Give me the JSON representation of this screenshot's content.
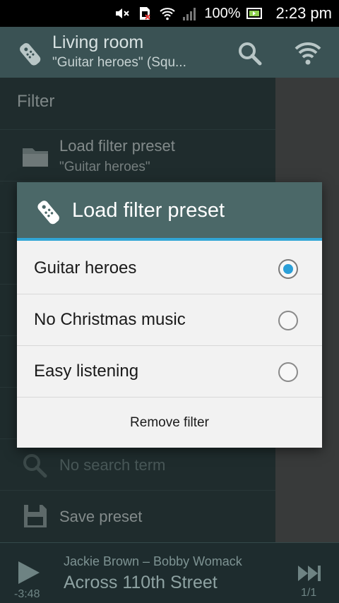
{
  "status_bar": {
    "battery": "100%",
    "time": "2:23 pm",
    "icons": [
      "mute-icon",
      "sim-error-icon",
      "wifi-icon",
      "signal-icon",
      "battery-icon"
    ]
  },
  "action_bar": {
    "title": "Living room",
    "subtitle": "\"Guitar heroes\" (Squ...",
    "icons": [
      "remote-icon",
      "search-icon",
      "wifi-icon"
    ]
  },
  "drawer": {
    "header": "Filter",
    "rows": [
      {
        "icon": "folder-icon",
        "title": "Load filter preset",
        "subtitle": "\"Guitar heroes\""
      },
      {
        "icon": "search-icon",
        "title": "No search term"
      },
      {
        "icon": "save-icon",
        "title": "Save preset"
      }
    ]
  },
  "dialog": {
    "title": "Load filter preset",
    "icon": "remote-icon",
    "options": [
      {
        "label": "Guitar heroes",
        "selected": true
      },
      {
        "label": "No Christmas music",
        "selected": false
      },
      {
        "label": "Easy listening",
        "selected": false
      }
    ],
    "remove_label": "Remove filter"
  },
  "now_playing": {
    "artist_line": "Jackie Brown – Bobby Womack",
    "title": "Across 110th Street",
    "elapsed": "-3:48",
    "queue": "1/1"
  },
  "colors": {
    "accent": "#32a6d6",
    "dialog_header": "#4b6868",
    "action_bar": "#3a5254"
  }
}
